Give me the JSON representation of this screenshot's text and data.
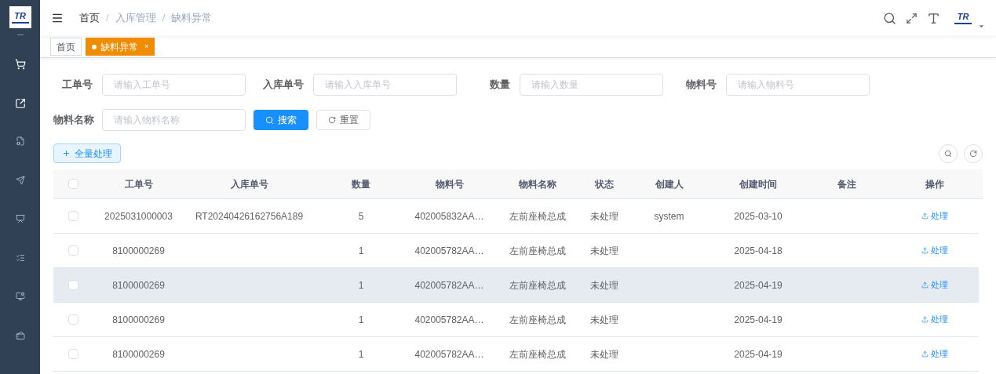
{
  "logo": {
    "text": "TR"
  },
  "breadcrumb": [
    {
      "label": "首页"
    },
    {
      "label": "入库管理"
    },
    {
      "label": "缺料异常"
    }
  ],
  "breadcrumb_separator": "/",
  "header_logo": {
    "text": "TR"
  },
  "tags": [
    {
      "label": "首页",
      "selected": false,
      "closable": false
    },
    {
      "label": "缺料异常",
      "selected": true,
      "closable": true,
      "close": "×"
    }
  ],
  "filters": [
    {
      "label": "工单号",
      "placeholder": "请输入工单号"
    },
    {
      "label": "入库单号",
      "placeholder": "请输入入库单号"
    },
    {
      "label": "数量",
      "placeholder": "请输入数量"
    },
    {
      "label": "物料号",
      "placeholder": "请输入物料号"
    },
    {
      "label": "物料名称",
      "placeholder": "请输入物料名称"
    }
  ],
  "search_button": "搜索",
  "reset_button": "重置",
  "bulk_button": "全量处理",
  "table": {
    "all_checked": false,
    "columns": [
      "工单号",
      "入库单号",
      "数量",
      "物料号",
      "物料名称",
      "状态",
      "创建人",
      "创建时间",
      "备注",
      "操作"
    ],
    "rows": [
      {
        "checked": false,
        "hovered": false,
        "cells": [
          "2025031000003",
          "RT20240426162756A189",
          "5",
          "402005832AA…",
          "左前座椅总成",
          "未处理",
          "system",
          "2025-03-10",
          ""
        ],
        "action": "处理"
      },
      {
        "checked": false,
        "hovered": false,
        "cells": [
          "8100000269",
          "",
          "1",
          "402005782AA…",
          "左前座椅总成",
          "未处理",
          "",
          "2025-04-18",
          ""
        ],
        "action": "处理"
      },
      {
        "checked": false,
        "hovered": true,
        "cells": [
          "8100000269",
          "",
          "1",
          "402005782AA…",
          "左前座椅总成",
          "未处理",
          "",
          "2025-04-19",
          ""
        ],
        "action": "处理"
      },
      {
        "checked": false,
        "hovered": false,
        "cells": [
          "8100000269",
          "",
          "1",
          "402005782AA…",
          "左前座椅总成",
          "未处理",
          "",
          "2025-04-19",
          ""
        ],
        "action": "处理"
      },
      {
        "checked": false,
        "hovered": false,
        "cells": [
          "8100000269",
          "",
          "1",
          "402005782AA…",
          "左前座椅总成",
          "未处理",
          "",
          "2025-04-19",
          ""
        ],
        "action": "处理"
      }
    ]
  }
}
